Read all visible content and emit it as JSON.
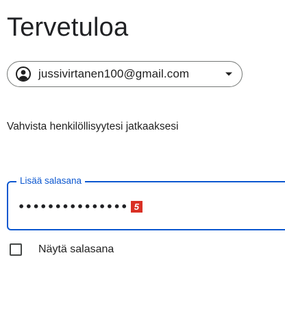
{
  "page": {
    "title": "Tervetuloa",
    "subtitle": "Vahvista henkilöllisyytesi jatkaaksesi"
  },
  "account": {
    "email": "jussivirtanen100@gmail.com",
    "avatar_icon": "account-circle-icon",
    "caret_icon": "caret-down-icon"
  },
  "password_field": {
    "label": "Lisää salasana",
    "value": "•••••••••••••••",
    "badge": "5"
  },
  "show_password": {
    "label": "Näytä salasana",
    "checked": false
  },
  "colors": {
    "accent": "#0b57d0",
    "text": "#1f1f1f",
    "border": "#747775",
    "badge": "#d93025"
  }
}
